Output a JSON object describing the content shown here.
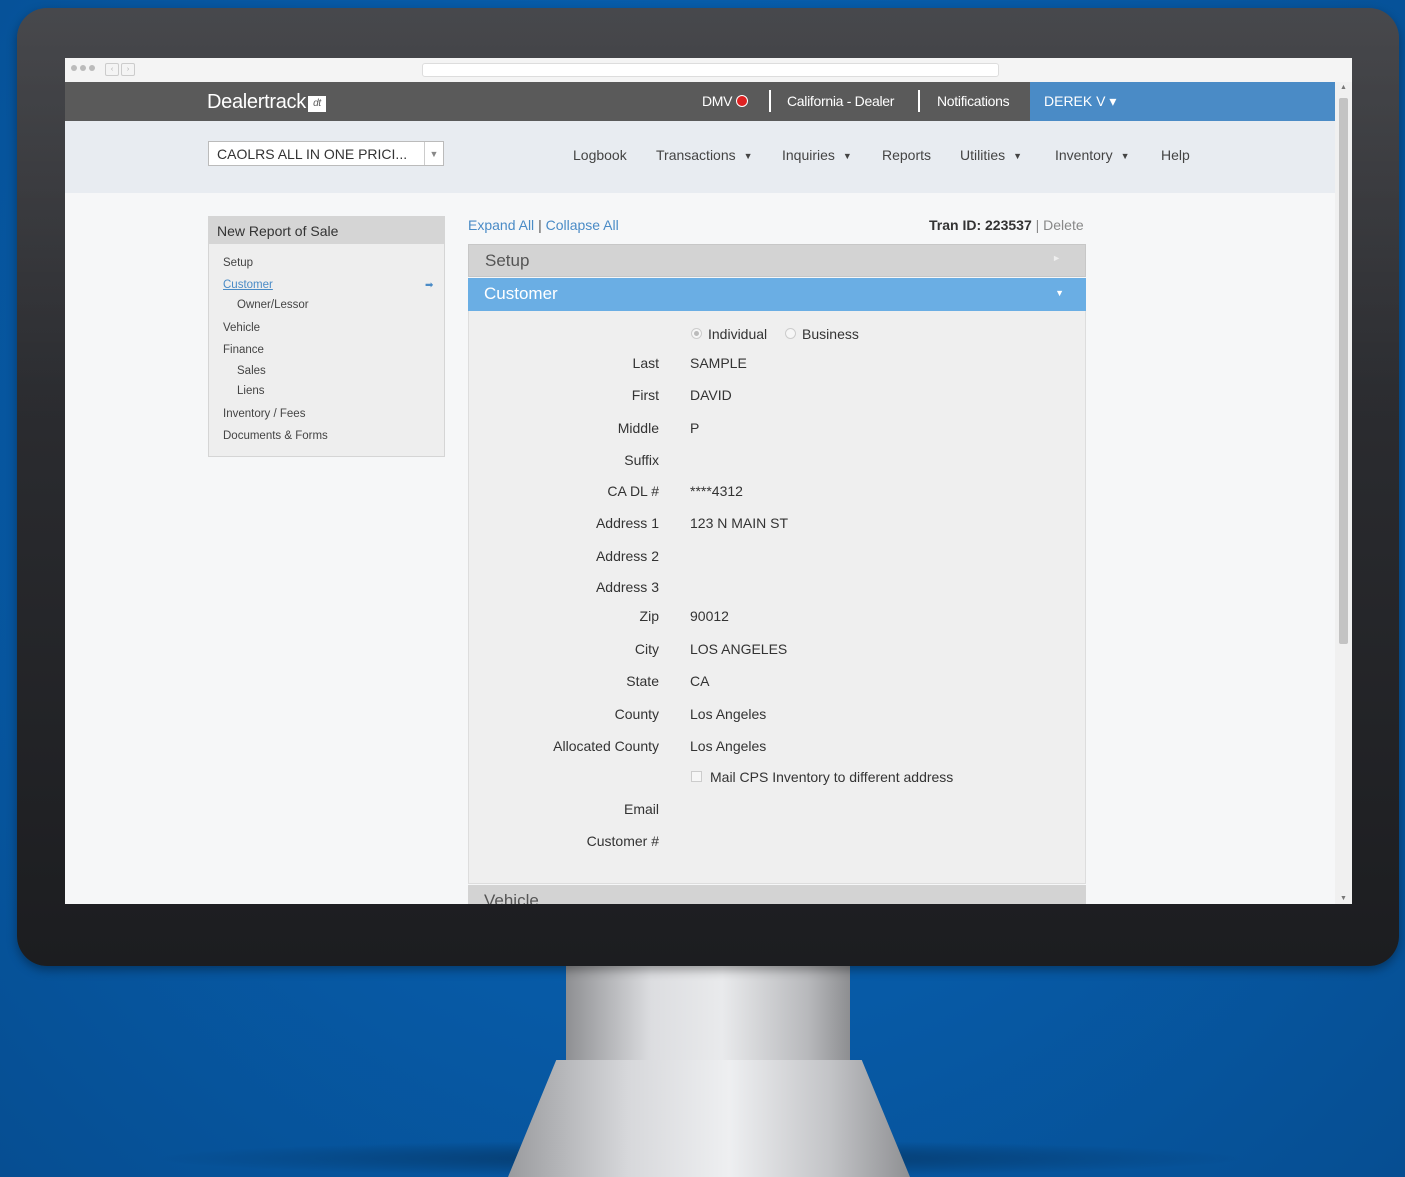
{
  "header": {
    "logo_text": "Dealertrack",
    "logo_badge": "dt",
    "dmv_label": "DMV",
    "dealer_label": "California - Dealer",
    "notifications_label": "Notifications",
    "user_label": "DEREK V ▾"
  },
  "nav": {
    "dealer_select_value": "CAOLRS ALL IN ONE PRICI...",
    "items": [
      {
        "label": "Logbook",
        "has_caret": false
      },
      {
        "label": "Transactions",
        "has_caret": true
      },
      {
        "label": "Inquiries",
        "has_caret": true
      },
      {
        "label": "Reports",
        "has_caret": false
      },
      {
        "label": "Utilities",
        "has_caret": true
      },
      {
        "label": "Inventory",
        "has_caret": true
      },
      {
        "label": "Help",
        "has_caret": false
      }
    ]
  },
  "sidebar": {
    "title": "New Report of Sale",
    "items": [
      {
        "label": "Setup"
      },
      {
        "label": "Customer",
        "active": true
      },
      {
        "label": "Owner/Lessor"
      },
      {
        "label": "Vehicle"
      },
      {
        "label": "Finance"
      },
      {
        "label": "Sales"
      },
      {
        "label": "Liens"
      },
      {
        "label": "Inventory / Fees"
      },
      {
        "label": "Documents & Forms"
      }
    ]
  },
  "toolbar": {
    "expand_all": "Expand All",
    "separator": "|",
    "collapse_all": "Collapse All",
    "tran_id_label": "Tran ID: 223537",
    "delete_label": "Delete"
  },
  "sections": {
    "setup": "Setup",
    "customer": "Customer",
    "vehicle": "Vehicle"
  },
  "customer_form": {
    "type_individual": "Individual",
    "type_business": "Business",
    "selected_type": "Individual",
    "fields": [
      {
        "label": "Last",
        "value": "SAMPLE"
      },
      {
        "label": "First",
        "value": "DAVID"
      },
      {
        "label": "Middle",
        "value": "P"
      },
      {
        "label": "Suffix",
        "value": ""
      },
      {
        "label": "CA DL #",
        "value": "****4312"
      },
      {
        "label": "Address 1",
        "value": "123 N MAIN ST"
      },
      {
        "label": "Address 2",
        "value": ""
      },
      {
        "label": "Address 3",
        "value": ""
      },
      {
        "label": "Zip",
        "value": "90012"
      },
      {
        "label": "City",
        "value": "LOS ANGELES"
      },
      {
        "label": "State",
        "value": "CA"
      },
      {
        "label": "County",
        "value": "Los Angeles"
      },
      {
        "label": "Allocated County",
        "value": "Los Angeles"
      }
    ],
    "mail_checkbox_label": "Mail CPS Inventory to different address",
    "mail_checked": false,
    "email_label": "Email",
    "customer_no_label": "Customer #"
  }
}
